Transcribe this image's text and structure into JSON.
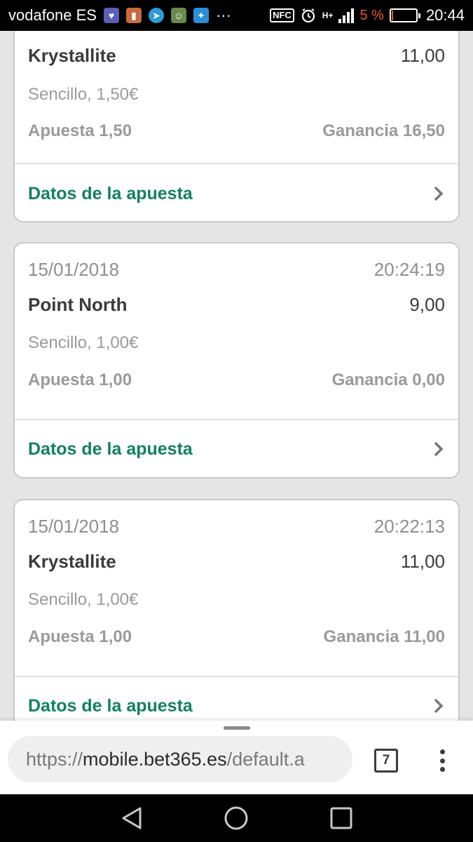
{
  "status_bar": {
    "carrier": "vodafone ES",
    "nfc": "NFC",
    "network": "H+",
    "battery_percent": "5 %",
    "battery_level": 0.05,
    "time": "20:44",
    "more": "···",
    "colors": {
      "battery_low": "#e8563a"
    }
  },
  "bets": [
    {
      "date": "",
      "time": "",
      "selection": "Krystallite",
      "odds": "11,00",
      "bet_type": "Sencillo, 1,50€",
      "stake": "Apuesta 1,50",
      "returns": "Ganancia 16,50",
      "details_label": "Datos de la apuesta"
    },
    {
      "date": "15/01/2018",
      "time": "20:24:19",
      "selection": "Point North",
      "odds": "9,00",
      "bet_type": "Sencillo, 1,00€",
      "stake": "Apuesta 1,00",
      "returns": "Ganancia 0,00",
      "details_label": "Datos de la apuesta"
    },
    {
      "date": "15/01/2018",
      "time": "20:22:13",
      "selection": "Krystallite",
      "odds": "11,00",
      "bet_type": "Sencillo, 1,00€",
      "stake": "Apuesta 1,00",
      "returns": "Ganancia 11,00",
      "details_label": "Datos de la apuesta"
    }
  ],
  "browser": {
    "url_scheme": "https://",
    "url_host": "mobile.bet365.es",
    "url_path": "/default.a",
    "tab_count": "7"
  },
  "icons": [
    "chevron-right-icon",
    "back-icon",
    "home-icon",
    "recents-icon",
    "menu-dots-icon",
    "tabs-icon"
  ],
  "colors": {
    "link_green": "#12825a",
    "background": "#e5e5e5"
  }
}
